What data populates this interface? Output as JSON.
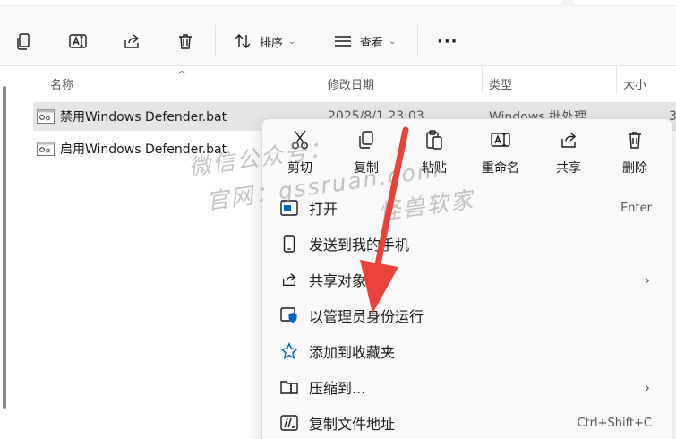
{
  "toolbar": {
    "sort_label": "排序",
    "view_label": "查看"
  },
  "columns": {
    "name": "名称",
    "modified": "修改日期",
    "type": "类型",
    "size": "大小"
  },
  "files": [
    {
      "name": "禁用Windows Defender.bat",
      "modified": "2025/8/1 23:03",
      "type": "Windows 批处理",
      "size": "3",
      "selected": true
    },
    {
      "name": "启用Windows Defender.bat",
      "modified": "",
      "type": "",
      "size": ""
    }
  ],
  "context_menu": {
    "quick_actions": [
      {
        "label": "剪切",
        "icon": "scissors-icon"
      },
      {
        "label": "复制",
        "icon": "copy-icon"
      },
      {
        "label": "粘贴",
        "icon": "paste-icon"
      },
      {
        "label": "重命名",
        "icon": "rename-icon"
      },
      {
        "label": "共享",
        "icon": "share-icon"
      },
      {
        "label": "删除",
        "icon": "trash-icon"
      }
    ],
    "items": [
      {
        "label": "打开",
        "shortcut": "Enter",
        "icon": "open-icon"
      },
      {
        "label": "发送到我的手机",
        "icon": "phone-icon"
      },
      {
        "label": "共享对象",
        "submenu": true,
        "icon": "share-icon"
      },
      {
        "label": "以管理员身份运行",
        "icon": "shield-icon"
      },
      {
        "label": "添加到收藏夹",
        "icon": "star-icon"
      },
      {
        "label": "压缩到...",
        "submenu": true,
        "icon": "zip-folder-icon"
      },
      {
        "label": "复制文件地址",
        "shortcut": "Ctrl+Shift+C",
        "icon": "copy-path-icon"
      }
    ],
    "submenu_arrow": "›"
  },
  "watermark": {
    "line1": "微信公众号：",
    "line2": "官网：gssruan.com",
    "brand": "怪兽软家"
  },
  "colors": {
    "accent": "#0067c0",
    "arrow": "#e8423a",
    "selected_row": "#e6e6e6"
  }
}
